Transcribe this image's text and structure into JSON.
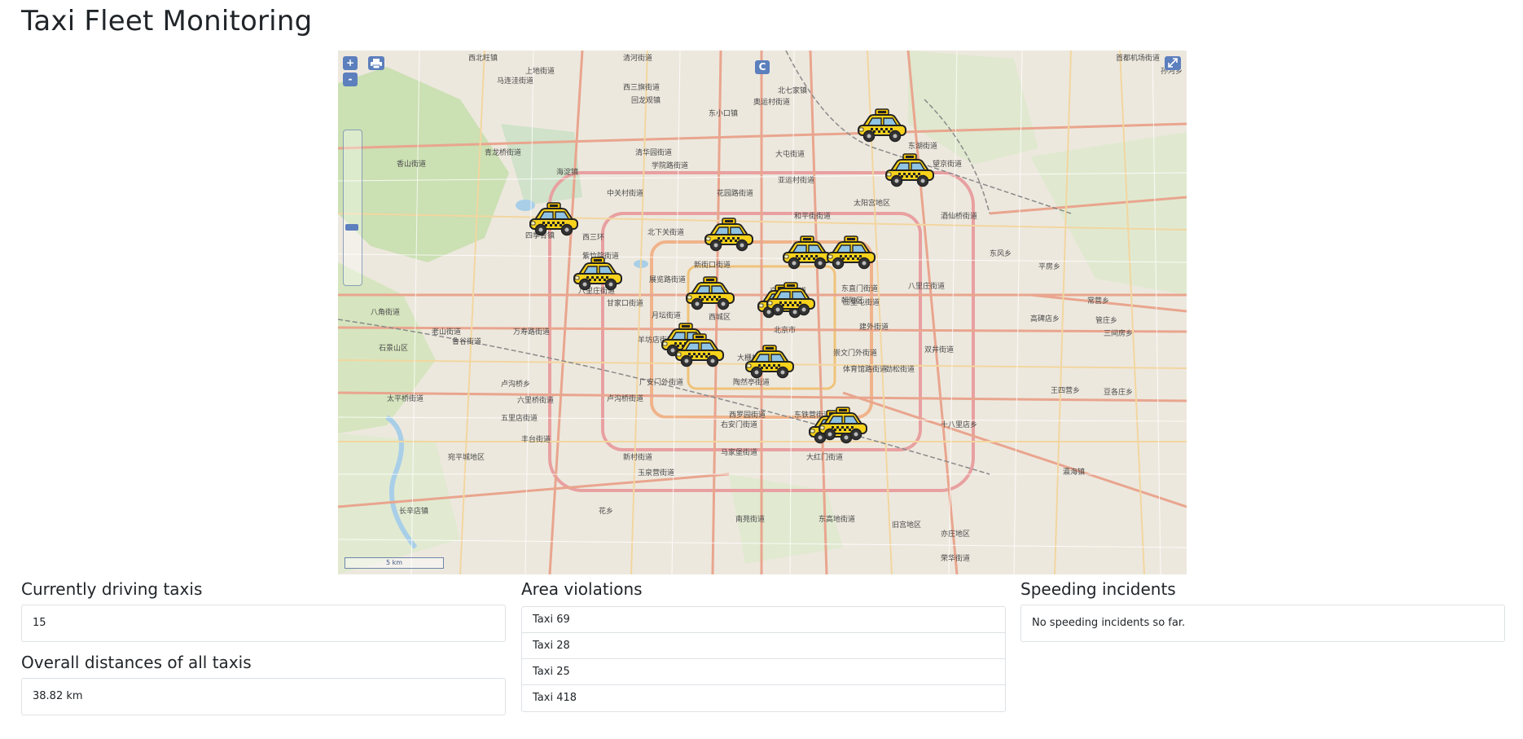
{
  "page": {
    "title": "Taxi Fleet Monitoring"
  },
  "map": {
    "controls": {
      "zoom_in": "+",
      "zoom_out": "-",
      "print_icon": "printer-icon",
      "layer_switch": "C",
      "fullscreen_icon": "fullscreen-icon"
    },
    "scale_label": "5 km",
    "labels": [
      "西北旺镇",
      "上地街道",
      "清河街道",
      "马连洼街道",
      "西三旗街道",
      "回龙观镇",
      "东小口镇",
      "北七家镇",
      "首都机场街道",
      "孙河乡",
      "奥运村街道",
      "东湖街道",
      "望京街道",
      "清华园街道",
      "学院路街道",
      "海淀镇",
      "大屯街道",
      "中关村街道",
      "花园路街道",
      "亚运村街道",
      "太阳宫地区",
      "香山街道",
      "青龙桥街道",
      "四季青镇",
      "西三环",
      "北下关街道",
      "北太平庄",
      "和平街街道",
      "酒仙桥街道",
      "紫竹院街道",
      "八里庄街道",
      "展览路街道",
      "新街口街道",
      "交道口街道",
      "东直门街道",
      "三里屯街道",
      "朝阳区",
      "八里庄街道",
      "东风乡",
      "平房乡",
      "常营乡",
      "八角街道",
      "老山街道",
      "甘家口街道",
      "月坛街道",
      "西城区",
      "北京市",
      "建外街道",
      "高碑店乡",
      "管庄乡",
      "石景山区",
      "鲁谷街道",
      "羊坊店街道",
      "万寿路街道",
      "大栅栏",
      "崇文门外街道",
      "双井街道",
      "三间房乡",
      "五里店街道",
      "广安门外街道",
      "陶然亭街道",
      "体育馆路街道",
      "劲松街道",
      "王四营乡",
      "豆各庄乡",
      "六里桥街道",
      "卢沟桥街道",
      "丰台街道",
      "西罗园街道",
      "东铁营街道",
      "十八里店乡",
      "太平桥街道",
      "右安门街道",
      "卢沟桥乡",
      "宛平城地区",
      "新村街道",
      "马家堡街道",
      "大红门街道",
      "长辛店镇",
      "玉泉营街道",
      "花乡",
      "南苑街道",
      "东高地街道",
      "旧宫地区",
      "亦庄地区",
      "瀛海镇",
      "荣华街道"
    ],
    "taxi_icon": "taxi-icon"
  },
  "driving": {
    "heading": "Currently driving taxis",
    "value": "15"
  },
  "distance": {
    "heading": "Overall distances of all taxis",
    "value": "38.82 km"
  },
  "violations": {
    "heading": "Area violations",
    "items": [
      "Taxi 69",
      "Taxi 28",
      "Taxi 25",
      "Taxi 418"
    ]
  },
  "speeding": {
    "heading": "Speeding incidents",
    "message": "No speeding incidents so far."
  }
}
